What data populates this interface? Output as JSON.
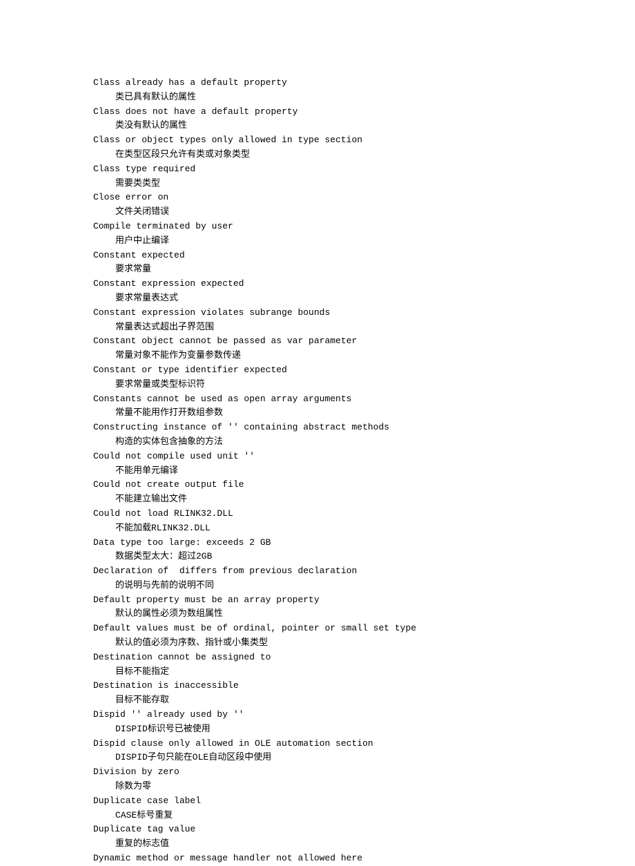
{
  "entries": [
    {
      "en": "Class already has a default property",
      "zh": "类已具有默认的属性"
    },
    {
      "en": "Class does not have a default property",
      "zh": "类没有默认的属性"
    },
    {
      "en": "Class or object types only allowed in type section",
      "zh": "在类型区段只允许有类或对象类型"
    },
    {
      "en": "Class type required",
      "zh": "需要类类型"
    },
    {
      "en": "Close error on",
      "zh": "文件关闭错误"
    },
    {
      "en": "Compile terminated by user",
      "zh": "用户中止编译"
    },
    {
      "en": "Constant expected",
      "zh": "要求常量"
    },
    {
      "en": "Constant expression expected",
      "zh": "要求常量表达式"
    },
    {
      "en": "Constant expression violates subrange bounds",
      "zh": "常量表达式超出子界范围"
    },
    {
      "en": "Constant object cannot be passed as var parameter",
      "zh": "常量对象不能作为变量参数传递"
    },
    {
      "en": "Constant or type identifier expected",
      "zh": "要求常量或类型标识符"
    },
    {
      "en": "Constants cannot be used as open array arguments",
      "zh": "常量不能用作打开数组参数"
    },
    {
      "en": "Constructing instance of '' containing abstract methods",
      "zh": "构造的实体包含抽象的方法"
    },
    {
      "en": "Could not compile used unit ''",
      "zh": "不能用单元编译"
    },
    {
      "en": "Could not create output file",
      "zh": "不能建立输出文件"
    },
    {
      "en": "Could not load RLINK32.DLL",
      "zh": "不能加载RLINK32.DLL"
    },
    {
      "en": "Data type too large: exceeds 2 GB",
      "zh": "数据类型太大：超过2GB"
    },
    {
      "en": "Declaration of  differs from previous declaration",
      "zh": "的说明与先前的说明不同"
    },
    {
      "en": "Default property must be an array property",
      "zh": "默认的属性必须为数组属性"
    },
    {
      "en": "Default values must be of ordinal, pointer or small set type",
      "zh": "默认的值必须为序数、指针或小集类型"
    },
    {
      "en": "Destination cannot be assigned to",
      "zh": "目标不能指定"
    },
    {
      "en": "Destination is inaccessible",
      "zh": "目标不能存取"
    },
    {
      "en": "Dispid '' already used by ''",
      "zh": "DISPID标识号已被使用"
    },
    {
      "en": "Dispid clause only allowed in OLE automation section",
      "zh": "DISPID子句只能在OLE自动区段中使用"
    },
    {
      "en": "Division by zero",
      "zh": "除数为零"
    },
    {
      "en": "Duplicate case label",
      "zh": "CASE标号重复"
    },
    {
      "en": "Duplicate tag value",
      "zh": "重复的标志值"
    },
    {
      "en": "Dynamic method or message handler not allowed here",
      "zh": ""
    }
  ]
}
